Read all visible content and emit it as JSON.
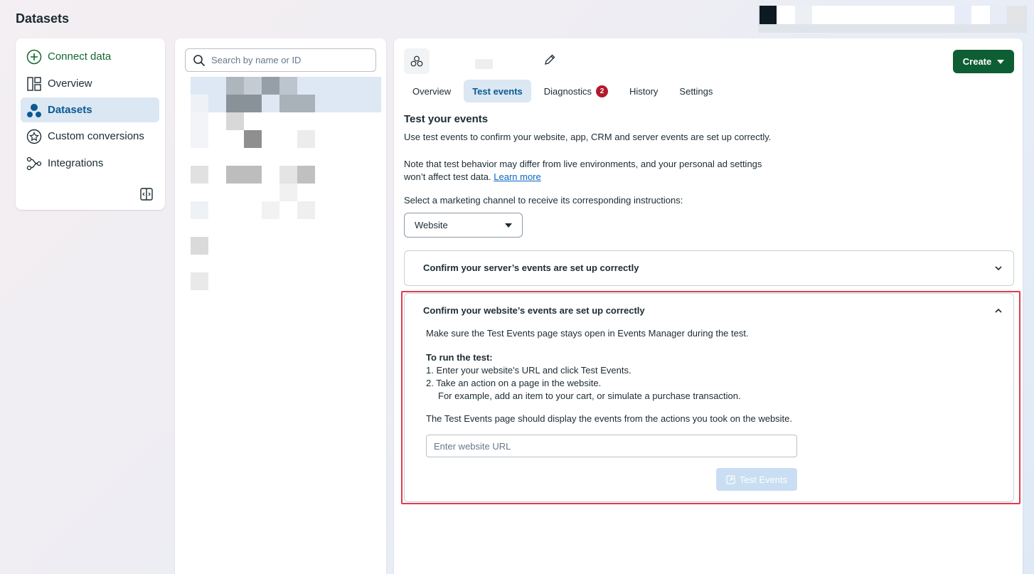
{
  "page_title": "Datasets",
  "nav": {
    "items": [
      {
        "label": "Connect data",
        "icon": "plus-circle-icon"
      },
      {
        "label": "Overview",
        "icon": "layout-icon"
      },
      {
        "label": "Datasets",
        "icon": "datasets-icon",
        "active": true
      },
      {
        "label": "Custom conversions",
        "icon": "star-badge-icon"
      },
      {
        "label": "Integrations",
        "icon": "integrations-icon"
      }
    ]
  },
  "search": {
    "placeholder": "Search by name or ID"
  },
  "header": {
    "create_label": "Create"
  },
  "tabs": [
    {
      "label": "Overview"
    },
    {
      "label": "Test events",
      "active": true
    },
    {
      "label": "Diagnostics",
      "badge": "2"
    },
    {
      "label": "History"
    },
    {
      "label": "Settings"
    }
  ],
  "content": {
    "title": "Test your events",
    "intro": "Use test events to confirm your website, app, CRM and server events are set up correctly.",
    "note_line1": "Note that test behavior may differ from live environments, and your personal ad settings",
    "note_line2": "won’t affect test data.",
    "learn_more": "Learn more",
    "channel_prompt": "Select a marketing channel to receive its corresponding instructions:",
    "channel_value": "Website",
    "server_accordion": "Confirm your server’s events are set up correctly",
    "website_accordion": {
      "title": "Confirm your website’s events are set up correctly",
      "intro": "Make sure the Test Events page stays open in Events Manager during the test.",
      "steps_title": "To run the test:",
      "step1": "1.  Enter your website's URL and click Test Events.",
      "step2": "2.  Take an action on a page in the website.",
      "step2_detail": "For example, add an item to your cart, or simulate a purchase transaction.",
      "outro": "The Test Events page should display the events from the actions you took on the website.",
      "url_placeholder": "Enter website URL",
      "test_button": "Test Events"
    }
  },
  "colors": {
    "accent": "#0a5a94",
    "create": "#0e5e33",
    "badge": "#b4182d",
    "highlight": "#e03c4d"
  }
}
